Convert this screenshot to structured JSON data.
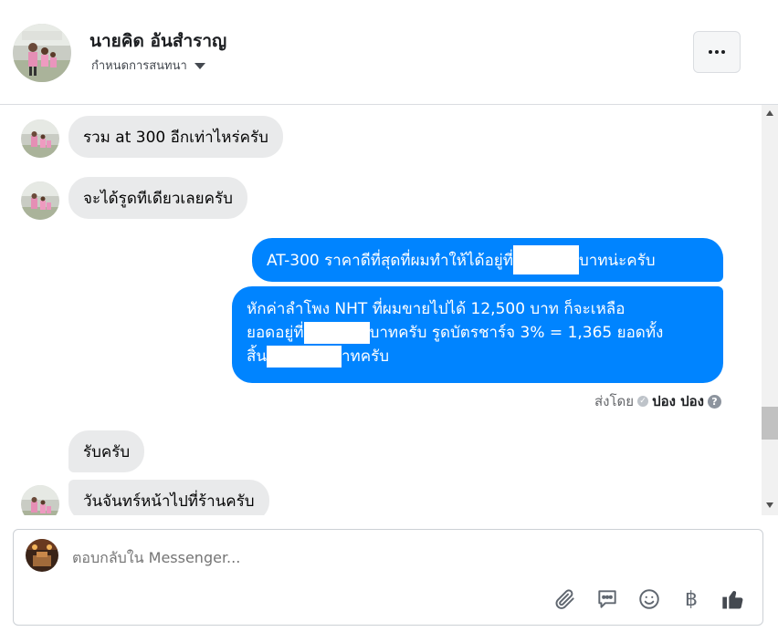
{
  "header": {
    "contact_name": "นายคิด อันสำราญ",
    "subtitle": "กำหนดการสนทนา",
    "more_icon": "more-horizontal-icon"
  },
  "messages": [
    {
      "from": "contact",
      "text": "รวม at 300 อีกเท่าไหร่ครับ"
    },
    {
      "from": "contact",
      "text": "จะได้รูดทีเดียวเลยครับ"
    },
    {
      "from": "me",
      "parts": [
        "AT-300 ราคาดีที่สุดที่ผมทำให้ได้อยู่ที่",
        "[redacted]",
        "บาทน่ะครับ"
      ]
    },
    {
      "from": "me",
      "lines": [
        [
          "หักค่าลำโพง NHT ที่ผมขายไปได้ 12,500 บาท ก็จะเหลือ"
        ],
        [
          "ยอดอยู่ที่",
          "[redacted]",
          "บาทครับ รูดบัตรชาร์จ 3% = 1,365 ยอดทั้ง"
        ],
        [
          "สิ้น",
          "[redacted]",
          "าทครับ"
        ]
      ]
    },
    {
      "from": "contact",
      "text": "รับครับ"
    },
    {
      "from": "contact",
      "text": "วันจันทร์หน้าไปที่ร้านครับ"
    }
  ],
  "seen": {
    "label": "ส่งโดย",
    "by": "ปอง ปอง",
    "help_symbol": "?"
  },
  "composer": {
    "placeholder": "ตอบกลับใน Messenger...",
    "tools": [
      "paperclip-icon",
      "chat-bubble-icon",
      "smiley-icon",
      "baht-icon",
      "thumbs-up-icon"
    ],
    "baht_symbol": "฿"
  },
  "colors": {
    "outgoing_bubble": "#0084ff",
    "incoming_bubble": "#e9eaeb",
    "accent": "#0084ff"
  }
}
